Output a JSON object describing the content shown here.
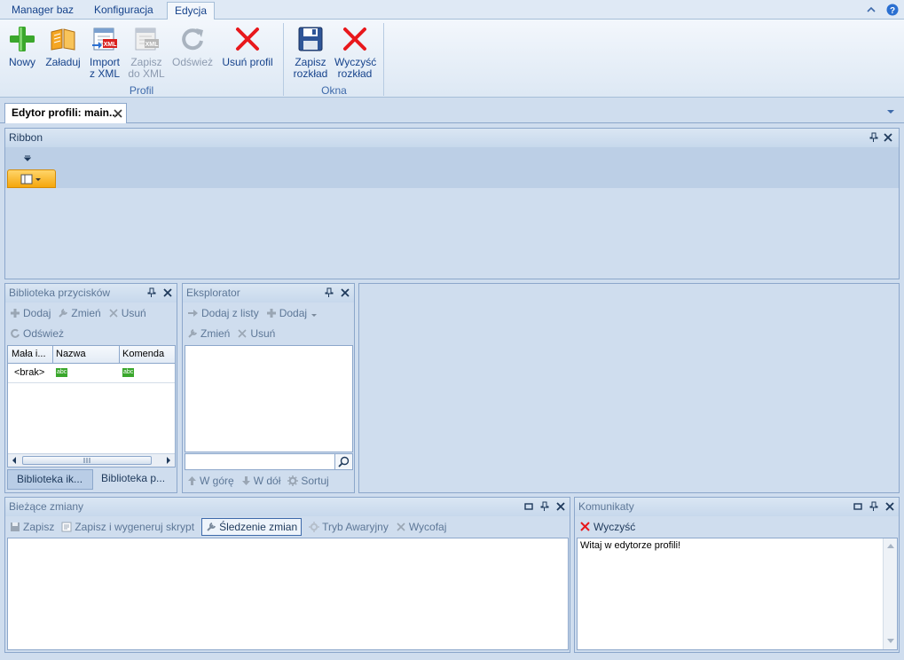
{
  "ribbon_tabs": [
    "Manager baz",
    "Konfiguracja",
    "Edycja"
  ],
  "ribbon": {
    "new": "Nowy",
    "load": "Załaduj",
    "import_l1": "Import",
    "import_l2": "z XML",
    "save_xml_l1": "Zapisz",
    "save_xml_l2": "do XML",
    "refresh": "Odśwież",
    "delete_profile": "Usuń profil",
    "group_profile": "Profil",
    "save_layout_l1": "Zapisz",
    "save_layout_l2": "rozkład",
    "clear_layout_l1": "Wyczyść",
    "clear_layout_l2": "rozkład",
    "group_windows": "Okna"
  },
  "doc_tab": "Edytor profili: main...",
  "ribbon_panel": {
    "title": "Ribbon"
  },
  "library": {
    "title": "Biblioteka przycisków",
    "add": "Dodaj",
    "change": "Zmień",
    "remove": "Usuń",
    "refresh": "Odśwież",
    "columns": [
      "Mała i...",
      "Nazwa",
      "Komenda"
    ],
    "row_first": "<brak>",
    "icon_badge": "abc",
    "tabs": [
      "Biblioteka ik...",
      "Biblioteka p..."
    ]
  },
  "explorer": {
    "title": "Eksplorator",
    "add_from_list": "Dodaj z listy",
    "add": "Dodaj",
    "change": "Zmień",
    "remove": "Usuń",
    "up": "W górę",
    "down": "W dół",
    "sort": "Sortuj"
  },
  "changes": {
    "title": "Bieżące zmiany",
    "save": "Zapisz",
    "save_script": "Zapisz i wygeneruj skrypt",
    "tracking": "Śledzenie zmian",
    "emergency": "Tryb Awaryjny",
    "revert": "Wycofaj"
  },
  "messages": {
    "title": "Komunikaty",
    "clear": "Wyczyść",
    "welcome": "Witaj w edytorze profili!"
  },
  "colors": {
    "accent": "#15428b",
    "panel_bg": "#cfddee",
    "border": "#8ca7cb",
    "red_x": "#e8181c",
    "green_plus": "#3aa72c"
  }
}
